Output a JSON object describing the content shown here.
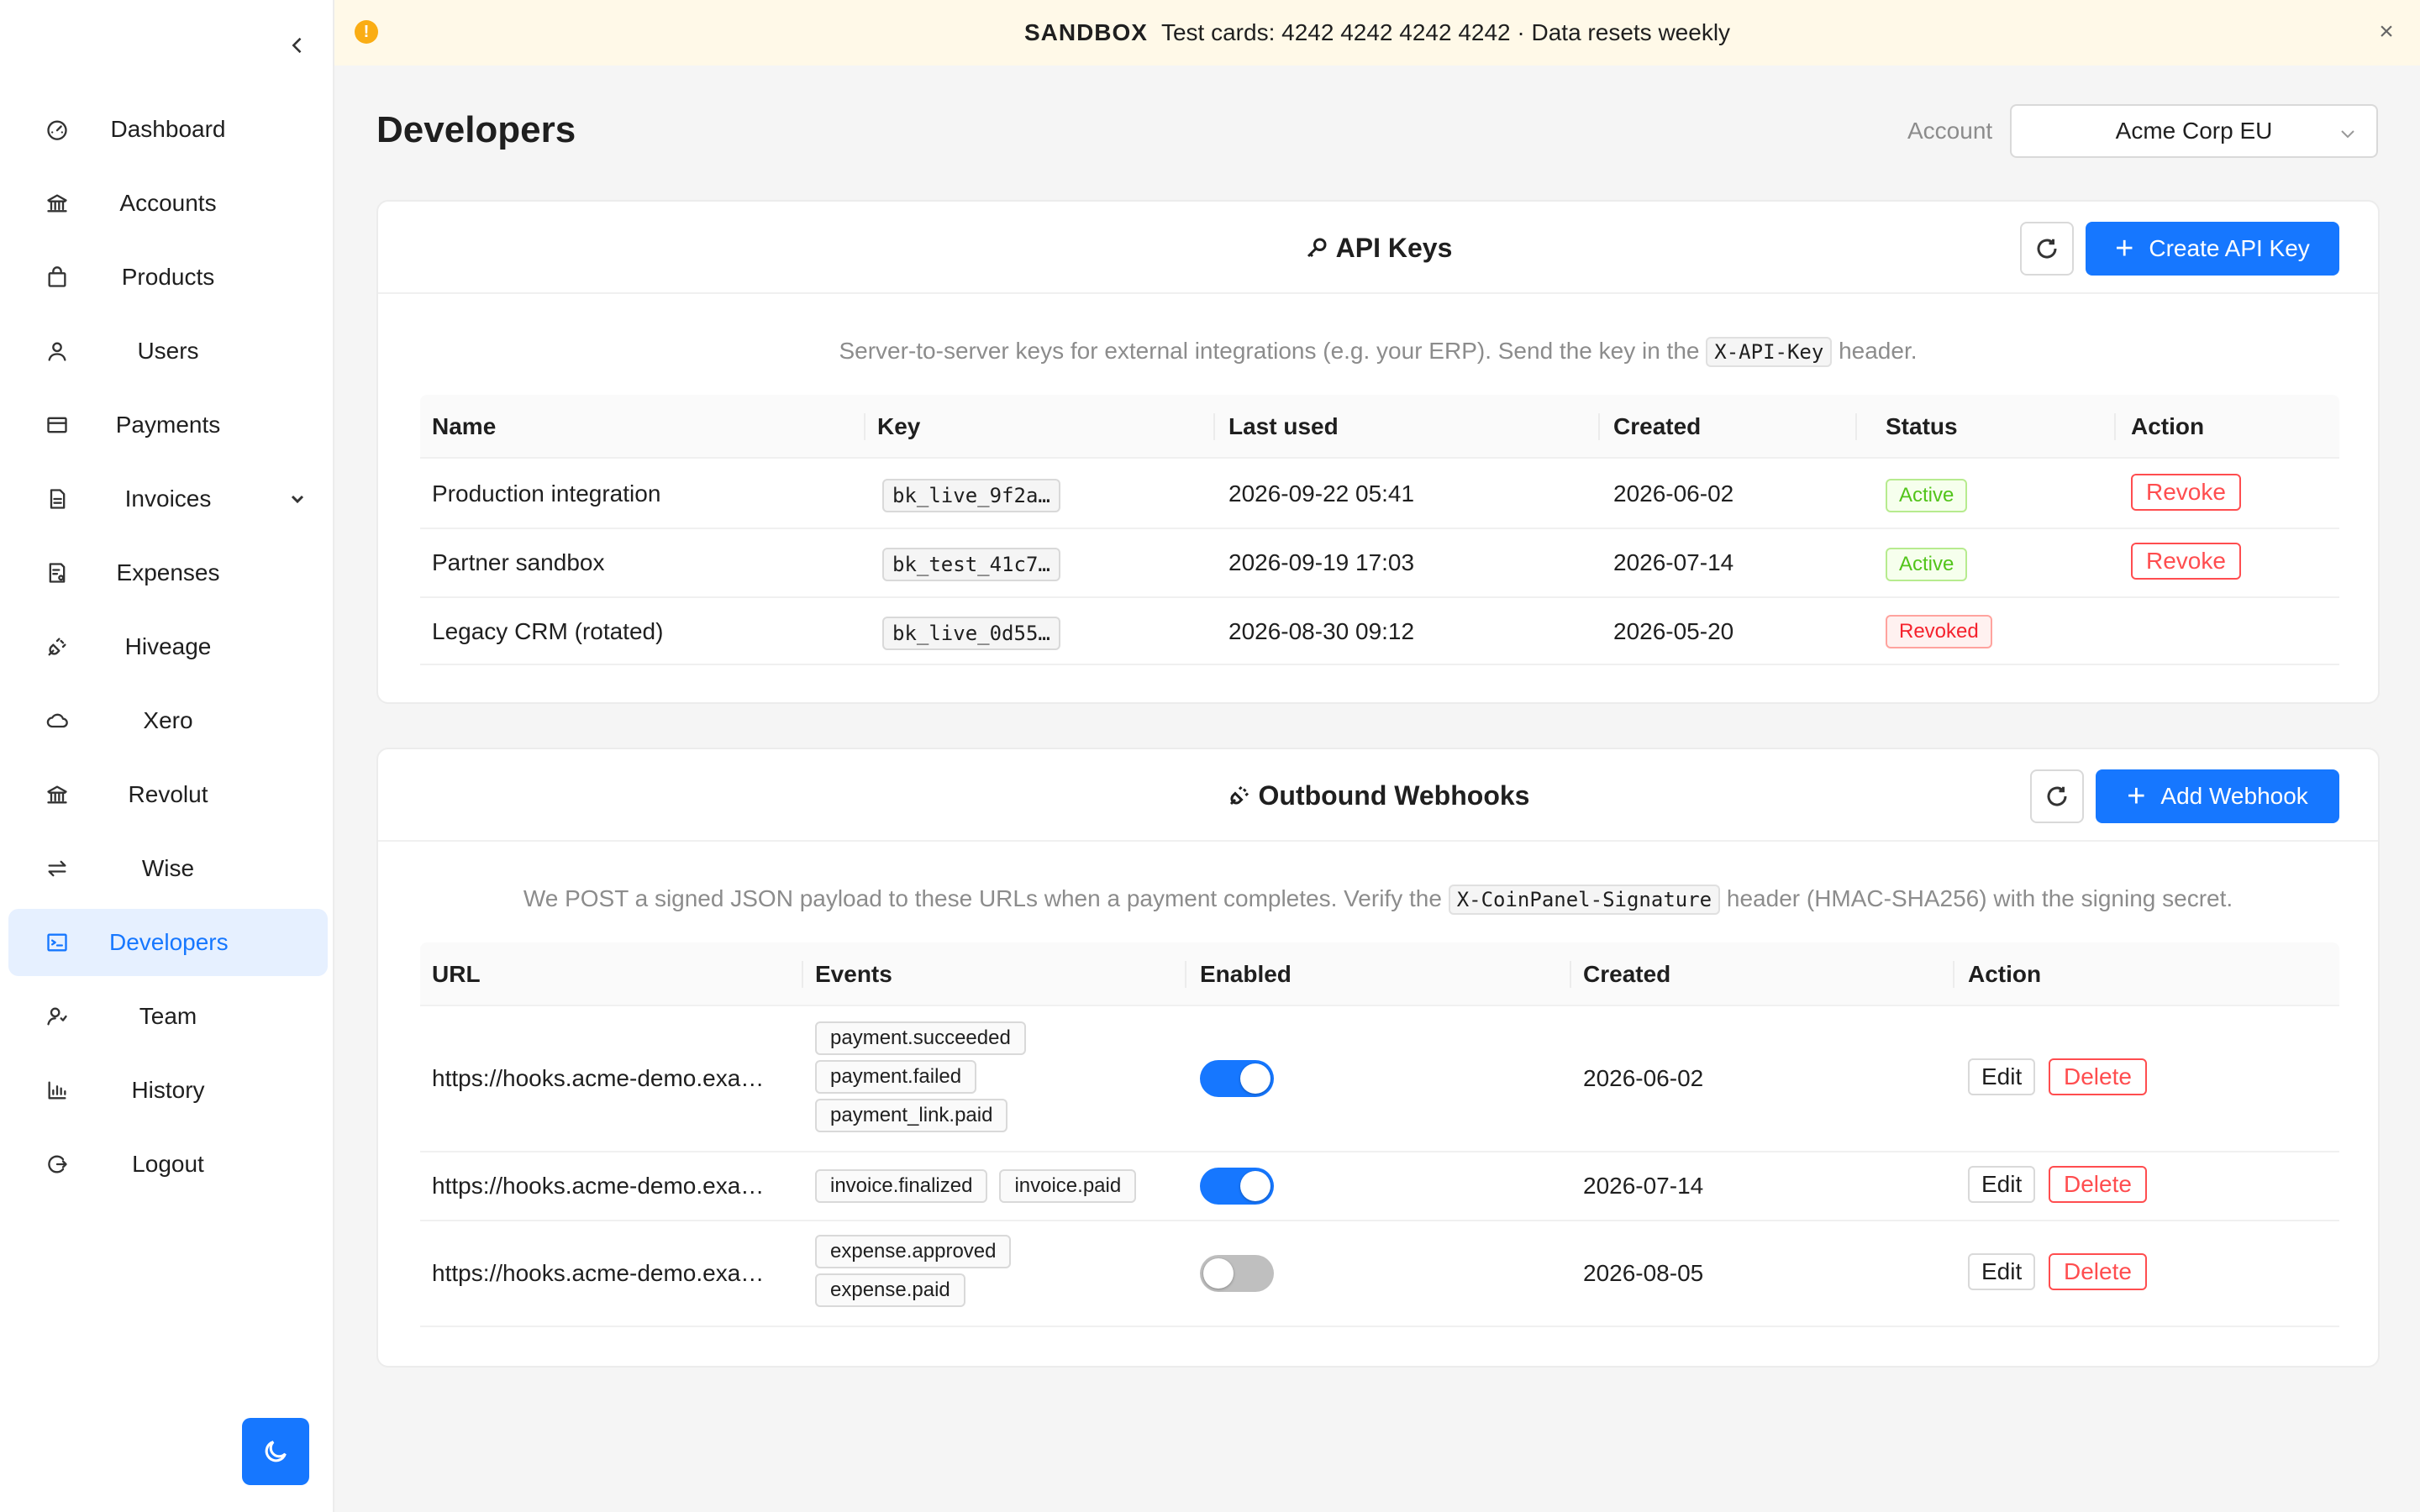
{
  "banner": {
    "tag": "SANDBOX",
    "text": "Test cards: 4242 4242 4242 4242 · Data resets weekly",
    "warn_icon": "!",
    "close_icon": "×"
  },
  "sidebar": {
    "items": [
      {
        "label": "Dashboard",
        "icon": "dashboard-icon"
      },
      {
        "label": "Accounts",
        "icon": "bank-icon"
      },
      {
        "label": "Products",
        "icon": "shopping-bag-icon"
      },
      {
        "label": "Users",
        "icon": "user-icon"
      },
      {
        "label": "Payments",
        "icon": "credit-card-icon"
      },
      {
        "label": "Invoices",
        "icon": "file-text-icon"
      },
      {
        "label": "Expenses",
        "icon": "receipt-icon"
      },
      {
        "label": "Hiveage",
        "icon": "plug-icon"
      },
      {
        "label": "Xero",
        "icon": "cloud-icon"
      },
      {
        "label": "Revolut",
        "icon": "bank-icon"
      },
      {
        "label": "Wise",
        "icon": "swap-icon"
      },
      {
        "label": "Developers",
        "icon": "terminal-icon"
      },
      {
        "label": "Team",
        "icon": "team-icon"
      },
      {
        "label": "History",
        "icon": "bar-chart-icon"
      },
      {
        "label": "Logout",
        "icon": "logout-icon"
      }
    ],
    "active": "Developers",
    "accent": "#1677ff"
  },
  "header": {
    "title": "Developers",
    "account_label": "Account",
    "account_value": "Acme Corp EU"
  },
  "api_keys": {
    "title": "API Keys",
    "create_label": "Create API Key",
    "desc_before": "Server-to-server keys for external integrations (e.g. your ERP). Send the key in the",
    "desc_code": "X-API-Key",
    "desc_after": "header.",
    "columns": [
      "Name",
      "Key",
      "Last used",
      "Created",
      "Status",
      "Action"
    ],
    "rows": [
      {
        "name": "Production integration",
        "key": "bk_live_9f2a…",
        "last_used": "2026-09-22 05:41",
        "created": "2026-06-02",
        "status": "Active",
        "action": "Revoke"
      },
      {
        "name": "Partner sandbox",
        "key": "bk_test_41c7…",
        "last_used": "2026-09-19 17:03",
        "created": "2026-07-14",
        "status": "Active",
        "action": "Revoke"
      },
      {
        "name": "Legacy CRM (rotated)",
        "key": "bk_live_0d55…",
        "last_used": "2026-08-30 09:12",
        "created": "2026-05-20",
        "status": "Revoked",
        "action": ""
      }
    ]
  },
  "webhooks": {
    "title": "Outbound Webhooks",
    "add_label": "Add Webhook",
    "desc_before": "We POST a signed JSON payload to these URLs when a payment completes. Verify the",
    "desc_code": "X-CoinPanel-Signature",
    "desc_after": "header (HMAC-SHA256) with the signing secret.",
    "columns": [
      "URL",
      "Events",
      "Enabled",
      "Created",
      "Action"
    ],
    "edit_label": "Edit",
    "delete_label": "Delete",
    "rows": [
      {
        "url": "https://hooks.acme-demo.exa…",
        "events": [
          "payment.succeeded",
          "payment.failed",
          "payment_link.paid"
        ],
        "enabled": true,
        "created": "2026-06-02"
      },
      {
        "url": "https://hooks.acme-demo.exa…",
        "events": [
          "invoice.finalized",
          "invoice.paid"
        ],
        "enabled": true,
        "created": "2026-07-14"
      },
      {
        "url": "https://hooks.acme-demo.exa…",
        "events": [
          "expense.approved",
          "expense.paid"
        ],
        "enabled": false,
        "created": "2026-08-05"
      }
    ]
  }
}
